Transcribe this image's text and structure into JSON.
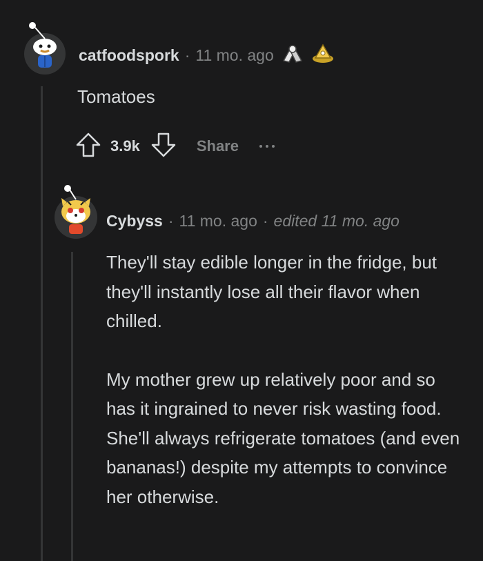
{
  "comment": {
    "username": "catfoodspork",
    "separator": "·",
    "time": "11 mo. ago",
    "avatar_icon": "snoo-avatar-icon",
    "awards": [
      "arm-wrestle-award-icon",
      "gold-pyramid-award-icon"
    ],
    "body": "Tomatoes",
    "score": "3.9k",
    "share_label": "Share",
    "upvote_icon": "upvote-arrow-icon",
    "downvote_icon": "downvote-arrow-icon",
    "more_icon": "more-options-icon"
  },
  "reply": {
    "username": "Cybyss",
    "separator": "·",
    "time": "11 mo. ago",
    "edited": "edited 11 mo. ago",
    "avatar_icon": "snoo-tiger-avatar-icon",
    "paragraphs": [
      "They'll stay edible longer in the fridge, but they'll instantly lose all their flavor when chilled.",
      "My mother grew up relatively poor and so has it ingrained to never risk wasting food. She'll always refrigerate tomatoes (and even bananas!) despite my attempts to convince her otherwise."
    ]
  },
  "colors": {
    "background": "#1a1a1b",
    "text": "#d7dadc",
    "meta": "#818384",
    "thread_line": "#343536"
  }
}
